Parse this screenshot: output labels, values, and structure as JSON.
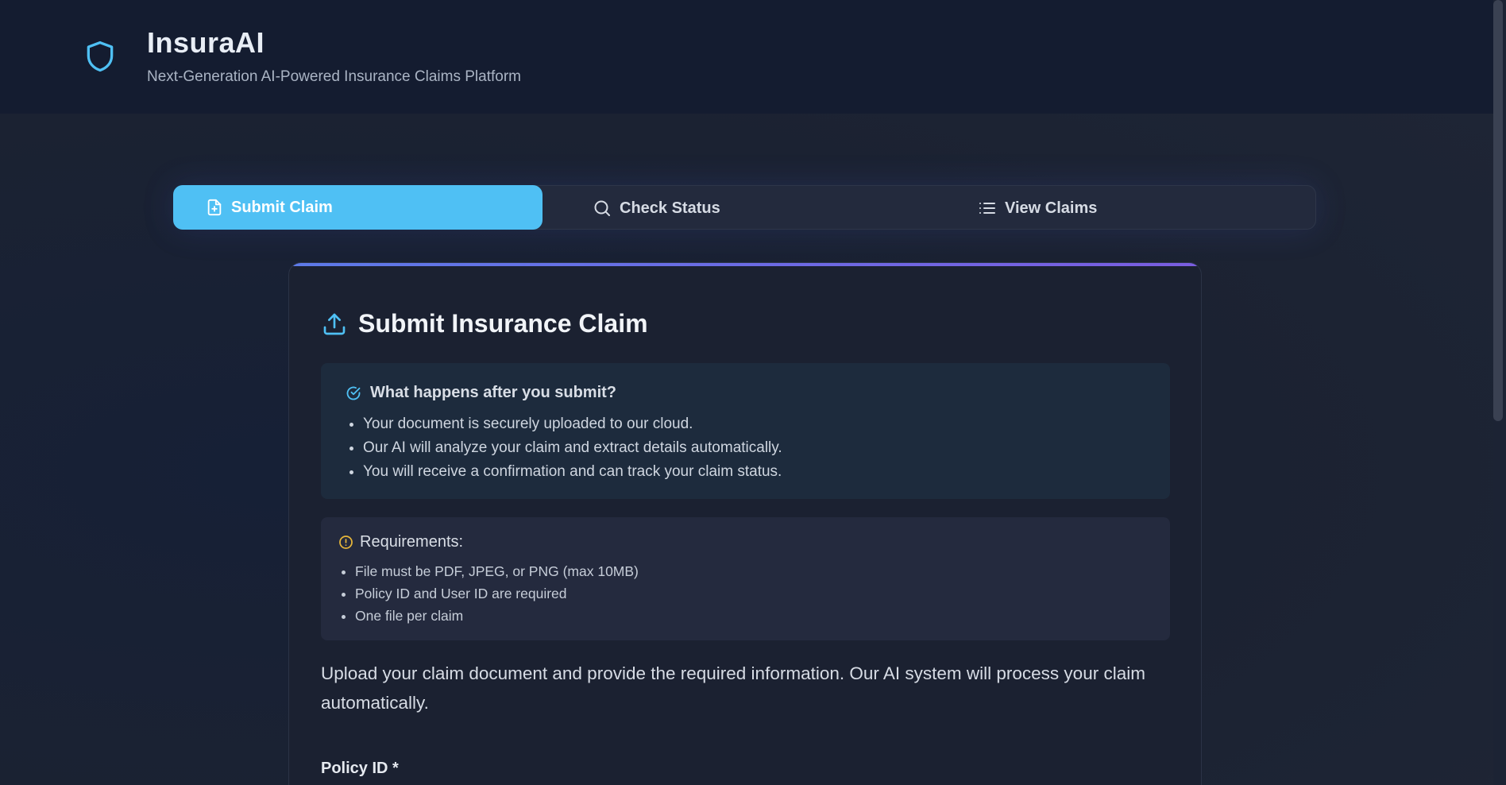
{
  "header": {
    "app_title": "InsuraAI",
    "subtitle": "Next-Generation AI-Powered Insurance Claims Platform",
    "logo_icon": "shield-icon"
  },
  "tabs": [
    {
      "label": "Submit Claim",
      "icon": "file-plus-icon",
      "active": true
    },
    {
      "label": "Check Status",
      "icon": "search-icon",
      "active": false
    },
    {
      "label": "View Claims",
      "icon": "list-icon",
      "active": false
    }
  ],
  "card": {
    "title": "Submit Insurance Claim",
    "title_icon": "upload-icon",
    "info": {
      "heading": "What happens after you submit?",
      "items": [
        "Your document is securely uploaded to our cloud.",
        "Our AI will analyze your claim and extract details automatically.",
        "You will receive a confirmation and can track your claim status."
      ]
    },
    "requirements": {
      "heading": "Requirements:",
      "items": [
        "File must be PDF, JPEG, or PNG (max 10MB)",
        "Policy ID and User ID are required",
        "One file per claim"
      ]
    },
    "intro": "Upload your claim document and provide the required information. Our AI system will process your claim automatically.",
    "policy_label": "Policy ID *"
  },
  "colors": {
    "accent": "#4fc0f4",
    "background": "#1b2232",
    "header_bg": "#141c30",
    "warning": "#e8b73a"
  }
}
